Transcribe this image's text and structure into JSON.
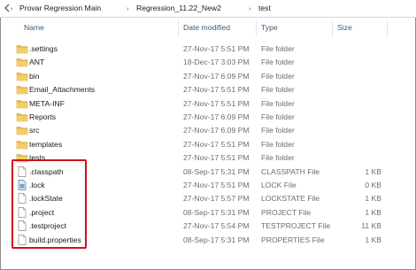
{
  "breadcrumb": {
    "parts": [
      "Provar Regression Main",
      "Regression_11.22_New2",
      "test"
    ]
  },
  "columns": {
    "name": "Name",
    "date": "Date modified",
    "type": "Type",
    "size": "Size"
  },
  "colors": {
    "folder": "#e8b94a",
    "folder_dark": "#d19d2a",
    "highlight": "#d10f1b",
    "header_text": "#3c5a7a"
  },
  "rows": [
    {
      "name": ".settings",
      "date": "27-Nov-17 5:51 PM",
      "type": "File folder",
      "size": "",
      "icon": "folder-icon"
    },
    {
      "name": "ANT",
      "date": "18-Dec-17 3:03 PM",
      "type": "File folder",
      "size": "",
      "icon": "folder-icon"
    },
    {
      "name": "bin",
      "date": "27-Nov-17 6:09 PM",
      "type": "File folder",
      "size": "",
      "icon": "folder-icon"
    },
    {
      "name": "Email_Attachments",
      "date": "27-Nov-17 5:51 PM",
      "type": "File folder",
      "size": "",
      "icon": "folder-icon"
    },
    {
      "name": "META-INF",
      "date": "27-Nov-17 5:51 PM",
      "type": "File folder",
      "size": "",
      "icon": "folder-icon"
    },
    {
      "name": "Reports",
      "date": "27-Nov-17 6:09 PM",
      "type": "File folder",
      "size": "",
      "icon": "folder-icon"
    },
    {
      "name": "src",
      "date": "27-Nov-17 6:09 PM",
      "type": "File folder",
      "size": "",
      "icon": "folder-icon"
    },
    {
      "name": "templates",
      "date": "27-Nov-17 5:51 PM",
      "type": "File folder",
      "size": "",
      "icon": "folder-icon"
    },
    {
      "name": "tests",
      "date": "27-Nov-17 5:51 PM",
      "type": "File folder",
      "size": "",
      "icon": "folder-icon"
    },
    {
      "name": ".classpath",
      "date": "08-Sep-17 5:31 PM",
      "type": "CLASSPATH File",
      "size": "1 KB",
      "icon": "file-icon"
    },
    {
      "name": ".lock",
      "date": "27-Nov-17 5:51 PM",
      "type": "LOCK File",
      "size": "0 KB",
      "icon": "lock-file-icon"
    },
    {
      "name": ".lockState",
      "date": "27-Nov-17 5:57 PM",
      "type": "LOCKSTATE File",
      "size": "1 KB",
      "icon": "file-icon"
    },
    {
      "name": ".project",
      "date": "08-Sep-17 5:31 PM",
      "type": "PROJECT File",
      "size": "1 KB",
      "icon": "file-icon"
    },
    {
      "name": ".testproject",
      "date": "27-Nov-17 5:54 PM",
      "type": "TESTPROJECT File",
      "size": "11 KB",
      "icon": "file-icon"
    },
    {
      "name": "build.properties",
      "date": "08-Sep-17 5:31 PM",
      "type": "PROPERTIES File",
      "size": "1 KB",
      "icon": "file-icon"
    }
  ]
}
